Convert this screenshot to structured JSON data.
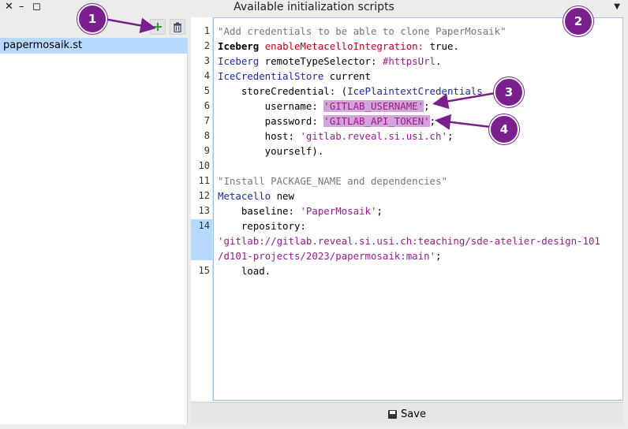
{
  "window": {
    "title": "Available initialization scripts",
    "controls": [
      "close",
      "minimize",
      "maximize"
    ]
  },
  "left": {
    "toolbar": [
      "add-icon",
      "trash-icon"
    ],
    "items": [
      {
        "label": "papermosaik.st",
        "selected": true
      }
    ]
  },
  "editor": {
    "line_numbers": [
      "1",
      "2",
      "3",
      "4",
      "5",
      "6",
      "7",
      "8",
      "9",
      "10",
      "11",
      "12",
      "13",
      "14",
      "",
      "15"
    ],
    "highlighted_line": "14",
    "lines": [
      "\"Add credentials to be able to clone PaperMosaik\"",
      "Iceberg enableMetacelloIntegration: true.",
      "Iceberg remoteTypeSelector: #httpsUrl.",
      "IceCredentialStore current",
      "    storeCredential: (IcePlaintextCredentials",
      "        username: 'GITLAB_USERNAME';",
      "        password: 'GITLAB_API_TOKEN';",
      "        host: 'gitlab.reveal.si.usi.ch';",
      "        yourself).",
      "",
      "\"Install PACKAGE_NAME and dependencies\"",
      "Metacello new",
      "    baseline: 'PaperMosaik';",
      "    repository:",
      "'gitlab://gitlab.reveal.si.usi.ch:teaching/sde-atelier-design-101",
      "/d101-projects/2023/papermosaik:main';",
      "    load."
    ],
    "tokens": {
      "l1": "\"Add credentials to be able to clone PaperMosaik\"",
      "l2a": "Iceberg",
      "l2b": "enableMetacelloIntegration:",
      "l2c": " true.",
      "l3a": "Iceberg",
      "l3b": " remoteTypeSelector: ",
      "l3c": "#httpsUrl",
      "l3d": ".",
      "l4a": "IceCredentialStore",
      "l4b": " current",
      "l5a": "    storeCredential: (",
      "l5b": "IcePlaintextCredentials",
      "l6a": "        username: ",
      "l6b": "'GITLAB_USERNAME'",
      "l6c": ";",
      "l7a": "        password: ",
      "l7b": "'GITLAB_API_TOKEN'",
      "l7c": ";",
      "l8a": "        host: ",
      "l8b": "'gitlab.reveal.si.usi.ch'",
      "l8c": ";",
      "l9": "        yourself).",
      "l11": "\"Install PACKAGE_NAME and dependencies\"",
      "l12a": "Metacello",
      "l12b": " new",
      "l13a": "    baseline: ",
      "l13b": "'PaperMosaik'",
      "l13c": ";",
      "l14": "    repository:",
      "l14b": "'gitlab://gitlab.reveal.si.usi.ch:teaching/sde-atelier-design-101",
      "l14c": "/d101-projects/2023/papermosaik:main'",
      "l14d": ";",
      "l15": "    load."
    }
  },
  "save_button": {
    "label": "Save",
    "icon": "floppy-disk-icon"
  },
  "callouts": [
    "1",
    "2",
    "3",
    "4"
  ],
  "colors": {
    "callout": "#7b1e8e",
    "selection": "#b8d9ff",
    "string_highlight": "#d3a4d7"
  }
}
